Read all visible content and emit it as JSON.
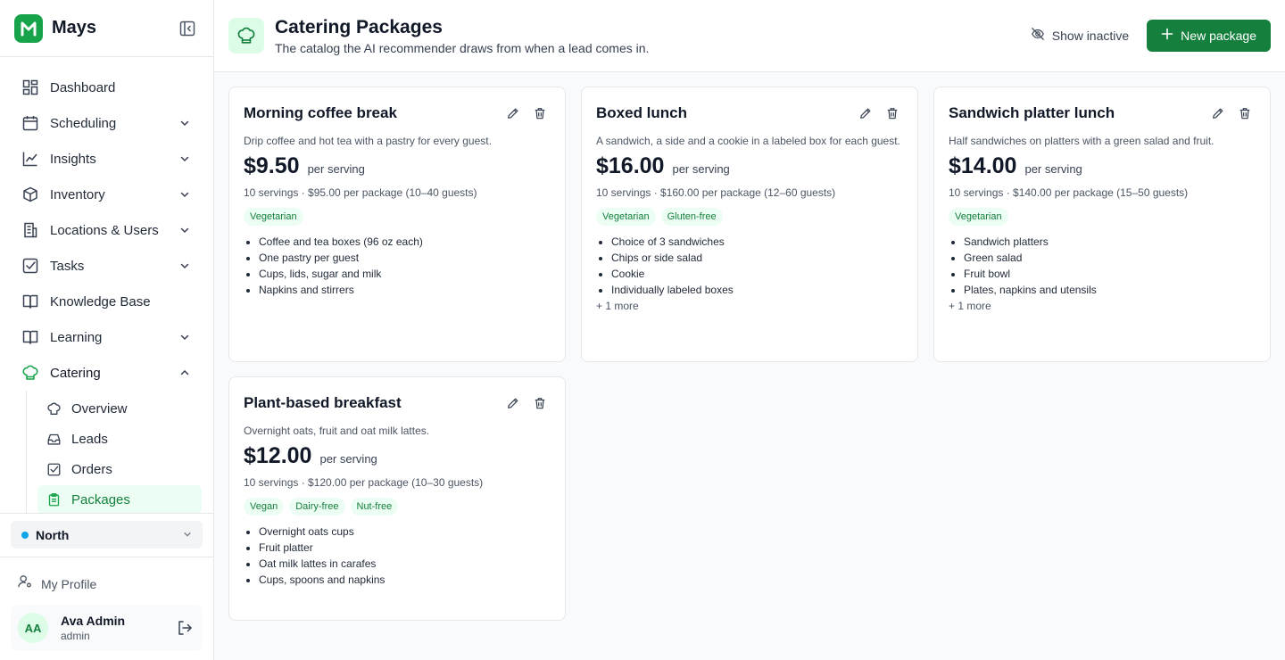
{
  "app": {
    "name": "Mays"
  },
  "nav": {
    "items": [
      {
        "label": "Dashboard",
        "icon": "dashboard-icon"
      },
      {
        "label": "Scheduling",
        "icon": "calendar-icon"
      },
      {
        "label": "Insights",
        "icon": "chart-icon"
      },
      {
        "label": "Inventory",
        "icon": "box-icon"
      },
      {
        "label": "Locations & Users",
        "icon": "building-icon"
      },
      {
        "label": "Tasks",
        "icon": "checkbox-icon"
      },
      {
        "label": "Knowledge Base",
        "icon": "book-icon"
      },
      {
        "label": "Learning",
        "icon": "book-open-icon"
      },
      {
        "label": "Catering",
        "icon": "chef-hat-icon"
      }
    ],
    "catering_sub": [
      {
        "label": "Overview",
        "icon": "chef-hat-icon"
      },
      {
        "label": "Leads",
        "icon": "inbox-icon"
      },
      {
        "label": "Orders",
        "icon": "checkbox-icon"
      },
      {
        "label": "Packages",
        "icon": "clipboard-icon"
      }
    ]
  },
  "location": {
    "label": "North"
  },
  "profile": {
    "link_label": "My Profile",
    "initials": "AA",
    "name": "Ava Admin",
    "role": "admin"
  },
  "header": {
    "title": "Catering Packages",
    "subtitle": "The catalog the AI recommender draws from when a lead comes in.",
    "show_inactive_label": "Show inactive",
    "new_package_label": "New package"
  },
  "packages": [
    {
      "name": "Morning coffee break",
      "description": "Drip coffee and hot tea with a pastry for every guest.",
      "price": "$9.50",
      "per": "per serving",
      "meta": "10 servings · $95.00 per package (10–40 guests)",
      "tags": [
        "Vegetarian"
      ],
      "items": [
        "Coffee and tea boxes (96 oz each)",
        "One pastry per guest",
        "Cups, lids, sugar and milk",
        "Napkins and stirrers"
      ],
      "more": ""
    },
    {
      "name": "Boxed lunch",
      "description": "A sandwich, a side and a cookie in a labeled box for each guest.",
      "price": "$16.00",
      "per": "per serving",
      "meta": "10 servings · $160.00 per package (12–60 guests)",
      "tags": [
        "Vegetarian",
        "Gluten-free"
      ],
      "items": [
        "Choice of 3 sandwiches",
        "Chips or side salad",
        "Cookie",
        "Individually labeled boxes"
      ],
      "more": "+ 1 more"
    },
    {
      "name": "Sandwich platter lunch",
      "description": "Half sandwiches on platters with a green salad and fruit.",
      "price": "$14.00",
      "per": "per serving",
      "meta": "10 servings · $140.00 per package (15–50 guests)",
      "tags": [
        "Vegetarian"
      ],
      "items": [
        "Sandwich platters",
        "Green salad",
        "Fruit bowl",
        "Plates, napkins and utensils"
      ],
      "more": "+ 1 more"
    },
    {
      "name": "Plant-based breakfast",
      "description": "Overnight oats, fruit and oat milk lattes.",
      "price": "$12.00",
      "per": "per serving",
      "meta": "10 servings · $120.00 per package (10–30 guests)",
      "tags": [
        "Vegan",
        "Dairy-free",
        "Nut-free"
      ],
      "items": [
        "Overnight oats cups",
        "Fruit platter",
        "Oat milk lattes in carafes",
        "Cups, spoons and napkins"
      ],
      "more": ""
    }
  ],
  "colors": {
    "brand": "#15803d",
    "accent_bg": "#ecfdf3",
    "location_dot": "#0ea5e9"
  }
}
